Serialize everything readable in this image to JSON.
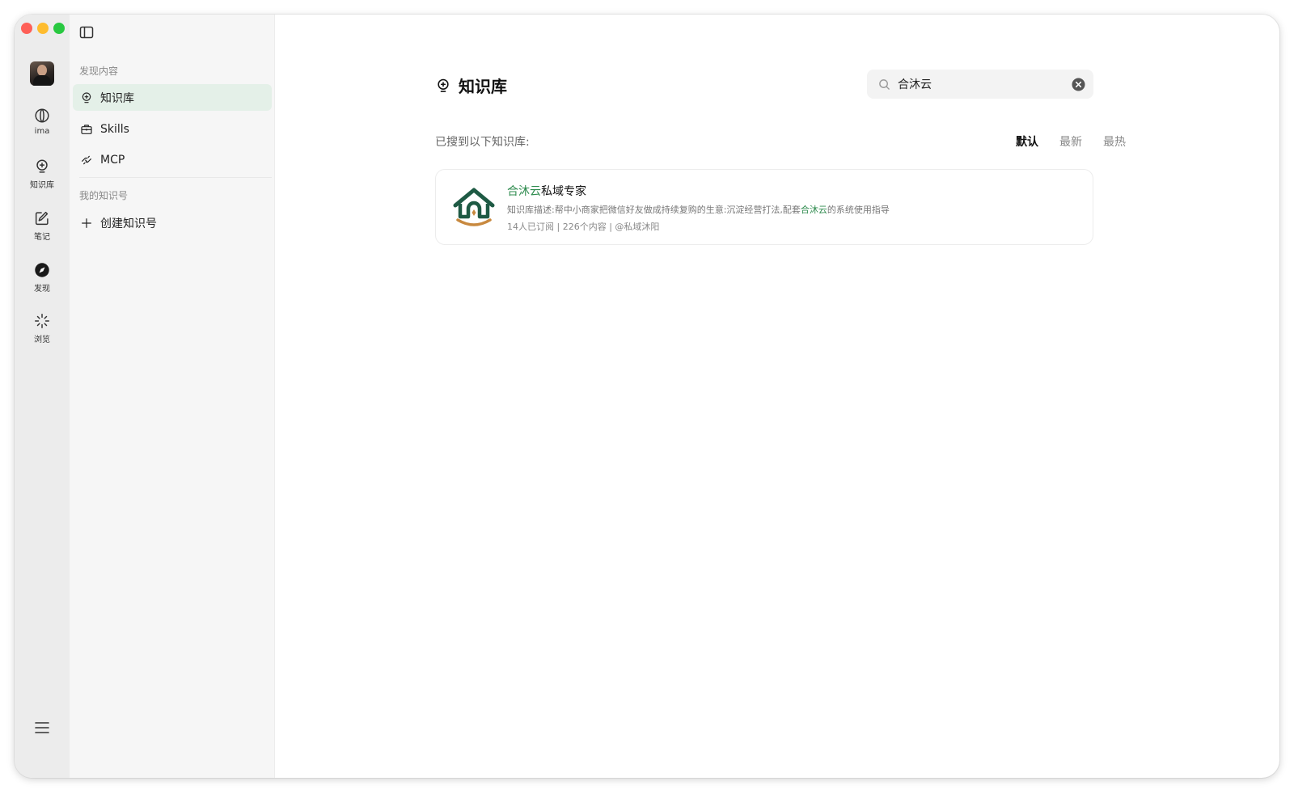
{
  "rail": {
    "items": [
      {
        "key": "ima",
        "label": "ima",
        "icon": "ima-logo-icon"
      },
      {
        "key": "knowledge",
        "label": "知识库",
        "icon": "bulb-pin-icon"
      },
      {
        "key": "notes",
        "label": "笔记",
        "icon": "note-pen-icon"
      },
      {
        "key": "discover",
        "label": "发现",
        "icon": "compass-icon"
      },
      {
        "key": "browse",
        "label": "浏览",
        "icon": "sparkle-burst-icon"
      }
    ]
  },
  "sidebar": {
    "discover_title": "发现内容",
    "items": [
      {
        "label": "知识库",
        "icon": "bulb-pin-icon",
        "active": true
      },
      {
        "label": "Skills",
        "icon": "toolbox-icon",
        "active": false
      },
      {
        "label": "MCP",
        "icon": "plug-link-icon",
        "active": false
      }
    ],
    "my_title": "我的知识号",
    "create_label": "创建知识号"
  },
  "main": {
    "title": "知识库",
    "search": {
      "value": "合沐云",
      "placeholder": ""
    },
    "result_hint": "已搜到以下知识库:",
    "sort_options": [
      {
        "label": "默认",
        "active": true
      },
      {
        "label": "最新",
        "active": false
      },
      {
        "label": "最热",
        "active": false
      }
    ],
    "results": [
      {
        "title_highlight": "合沐云",
        "title_rest": "私域专家",
        "desc_prefix": "知识库描述:帮中小商家把微信好友做成持续复购的生意:沉淀经营打法,配套",
        "desc_highlight": "合沐云",
        "desc_suffix": "的系统使用指导",
        "meta": "14人已订阅 | 226个内容 | @私域沐阳"
      }
    ]
  },
  "colors": {
    "accent": "#2e8b4e",
    "active_bg": "#e4f0e8",
    "logo_green": "#1e5a44",
    "logo_gold": "#c8893f"
  }
}
